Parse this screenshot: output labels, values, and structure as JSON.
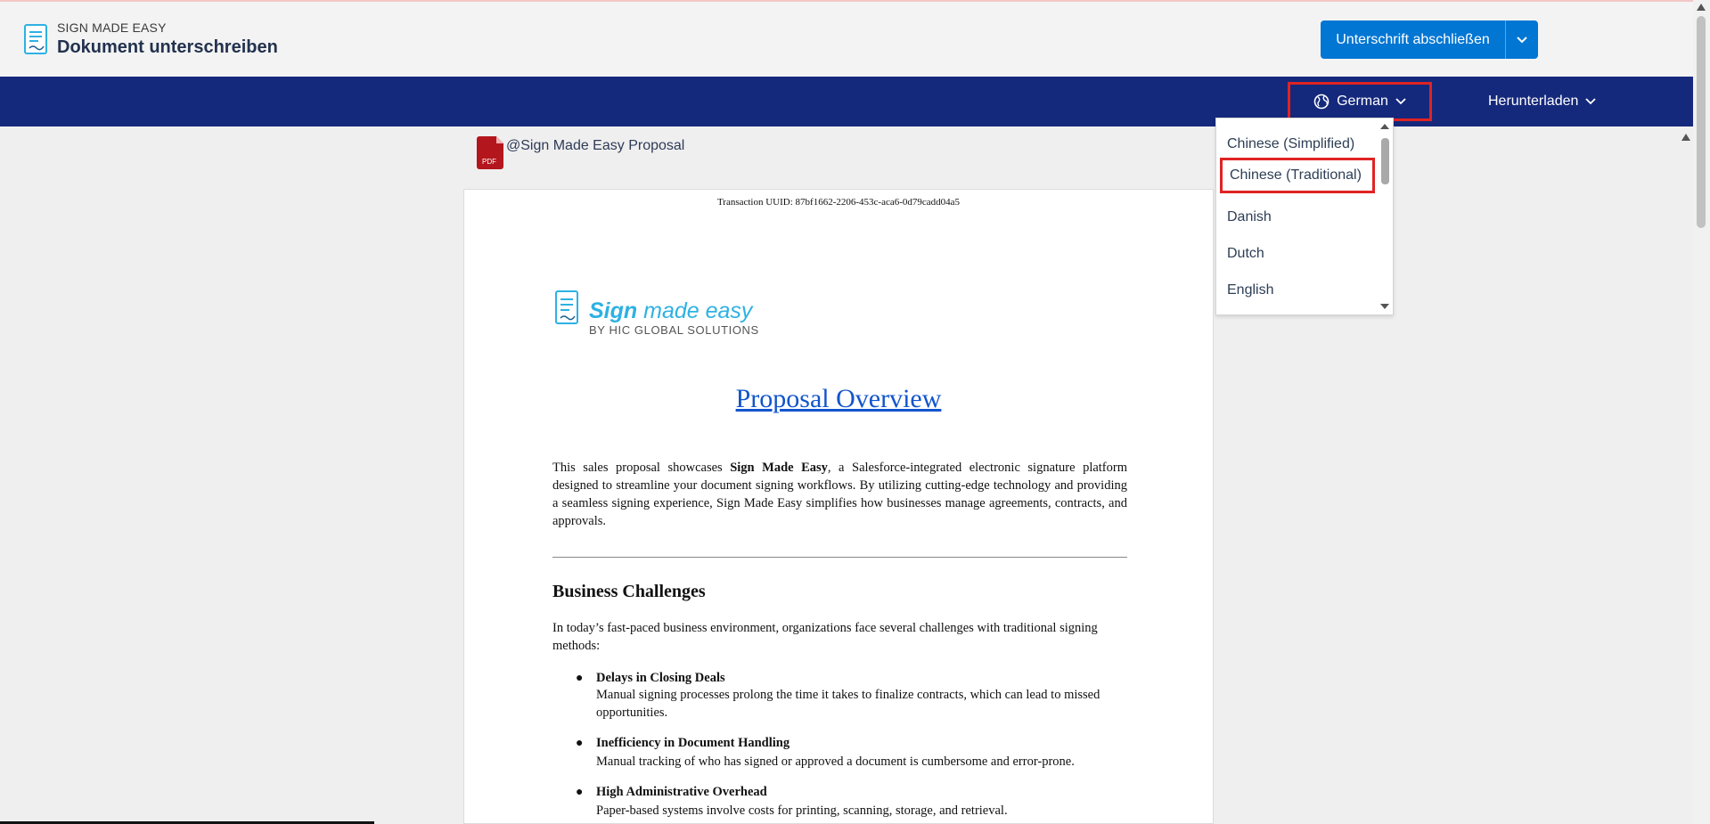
{
  "header": {
    "app_name": "SIGN MADE EASY",
    "page_title": "Dokument unterschreiben",
    "finish_button": "Unterschrift abschließen"
  },
  "navbar": {
    "language_selected": "German",
    "download_label": "Herunterladen"
  },
  "language_dropdown": {
    "options": [
      "Chinese (Simplified)",
      "Chinese (Traditional)",
      "Danish",
      "Dutch",
      "English"
    ],
    "highlighted": "Chinese (Traditional)"
  },
  "file": {
    "icon_label": "PDF",
    "name": "@Sign Made Easy Proposal"
  },
  "document": {
    "uuid": "Transaction UUID: 87bf1662-2206-453c-aca6-0d79cadd04a5",
    "logo_word1": "Sign",
    "logo_word2": "made easy",
    "logo_sub": "BY HIC GLOBAL SOLUTIONS",
    "title": "Proposal Overview",
    "para_part1": "This sales proposal showcases ",
    "para_bold": "Sign Made Easy",
    "para_part2": ", a Salesforce-integrated electronic signature platform designed to streamline your document signing workflows. By utilizing cutting-edge technology and providing a seamless signing experience, Sign Made Easy simplifies how businesses manage agreements, contracts, and approvals.",
    "section_heading": "Business Challenges",
    "section_intro": "In today’s fast-paced business environment, organizations face several challenges with traditional signing methods:",
    "bullets": [
      {
        "title": "Delays in Closing Deals",
        "text": "Manual signing processes prolong the time it takes to finalize contracts, which can lead to missed opportunities."
      },
      {
        "title": "Inefficiency in Document Handling",
        "text": "Manual tracking of who has signed or approved a document is cumbersome and error-prone."
      },
      {
        "title": "High Administrative Overhead",
        "text": "Paper-based systems involve costs for printing, scanning, storage, and retrieval."
      }
    ]
  },
  "colors": {
    "navbar": "#15297c",
    "primary_button": "#0176d3",
    "highlight_border": "#e02323",
    "pdf_icon": "#b3161c",
    "logo_blue": "#2eb1e3"
  }
}
